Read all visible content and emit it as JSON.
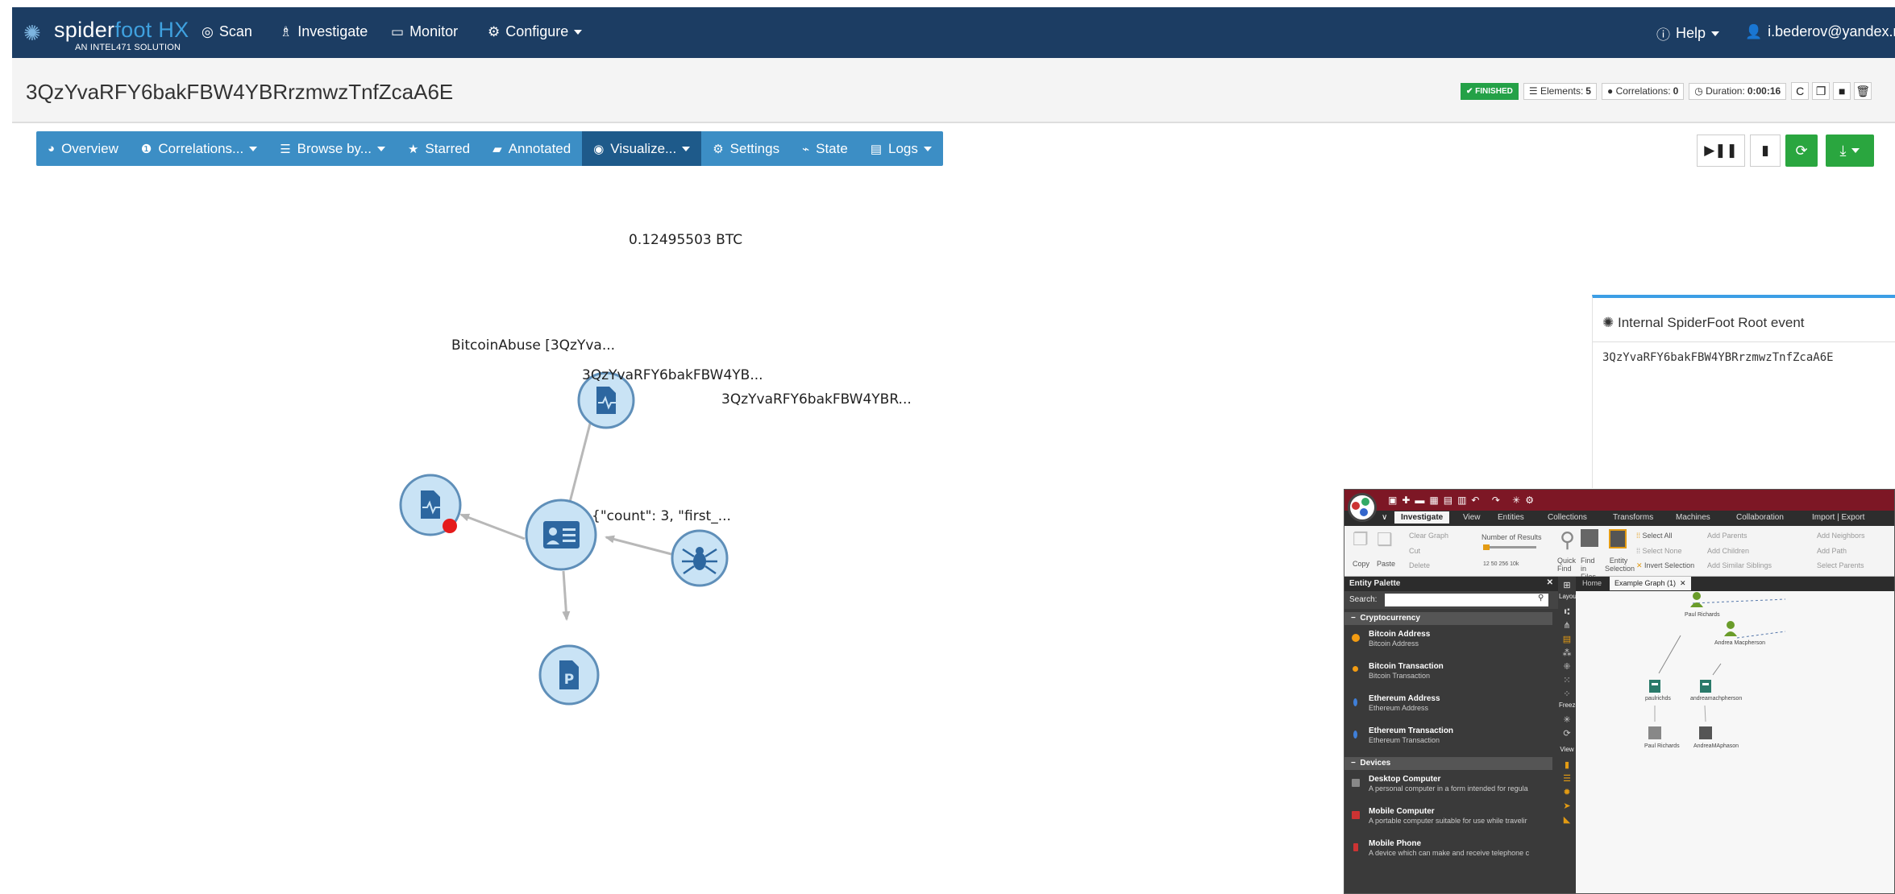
{
  "brand": {
    "name_a": "spider",
    "name_b": "foot HX",
    "tagline": "AN INTEL471 SOLUTION"
  },
  "nav": {
    "items": [
      {
        "label": "Scan",
        "icon": "scan-icon"
      },
      {
        "label": "Investigate",
        "icon": "investigate-icon"
      },
      {
        "label": "Monitor",
        "icon": "monitor-icon"
      },
      {
        "label": "Configure",
        "icon": "cogs-icon"
      }
    ],
    "help": "Help",
    "user": "i.bederov@yandex.ru"
  },
  "scan": {
    "title": "3QzYvaRFY6bakFBW4YBRrzmwzTnfZcaA6E",
    "status": "FINISHED",
    "elements_label": "Elements:",
    "elements": "5",
    "correlations_label": "Correlations:",
    "correlations": "0",
    "duration_label": "Duration:",
    "duration": "0:00:16"
  },
  "tabs": [
    {
      "label": "Overview",
      "icon": "dashboard-icon"
    },
    {
      "label": "Correlations...",
      "icon": "exclamation-icon"
    },
    {
      "label": "Browse by...",
      "icon": "list-icon"
    },
    {
      "label": "Starred",
      "icon": "star-icon"
    },
    {
      "label": "Annotated",
      "icon": "note-icon"
    },
    {
      "label": "Visualize...",
      "icon": "eye-icon",
      "active": true
    },
    {
      "label": "Settings",
      "icon": "gear-icon"
    },
    {
      "label": "State",
      "icon": "pulse-icon"
    },
    {
      "label": "Logs",
      "icon": "log-icon"
    }
  ],
  "graph": {
    "nodes": [
      {
        "label": "0.12495503 BTC",
        "icon": "document-pulse-icon"
      },
      {
        "label": "BitcoinAbuse [3QzYva...",
        "icon": "document-pulse-icon"
      },
      {
        "label": "3QzYvaRFY6bakFBW4YB...",
        "icon": "id-card-icon"
      },
      {
        "label": "3QzYvaRFY6bakFBW4YBR...",
        "icon": "spider-icon"
      },
      {
        "label": "{\"count\": 3, \"first_...",
        "icon": "document-p-icon"
      }
    ]
  },
  "detail_panel": {
    "title": "Internal SpiderFoot Root event",
    "value": "3QzYvaRFY6bakFBW4YBRrzmwzTnfZcaA6E"
  },
  "maltego": {
    "tabs": [
      "Investigate",
      "View",
      "Entities",
      "Collections",
      "Transforms",
      "Machines",
      "Collaboration",
      "Import | Export"
    ],
    "ribbon": {
      "copy": "Copy",
      "paste": "Paste",
      "clear_graph": "Clear Graph",
      "cut": "Cut",
      "delete": "Delete",
      "num_results": "Number of Results",
      "ticks": "12  50  256  10k",
      "quick_find": "Quick Find",
      "find_in_files": "Find in Files",
      "entity_selection": "Entity Selection",
      "select_all": "Select All",
      "select_none": "Select None",
      "invert_selection": "Invert Selection",
      "add_parents": "Add Parents",
      "add_children": "Add Children",
      "add_similar": "Add Similar Siblings",
      "add_neighbors": "Add Neighbors",
      "add_path": "Add Path",
      "select_parents": "Select Parents"
    },
    "palette": {
      "title": "Entity Palette",
      "search_label": "Search:",
      "categories": [
        {
          "name": "Cryptocurrency",
          "items": [
            {
              "title": "Bitcoin Address",
              "desc": "Bitcoin Address"
            },
            {
              "title": "Bitcoin Transaction",
              "desc": "Bitcoin Transaction"
            },
            {
              "title": "Ethereum Address",
              "desc": "Ethereum Address"
            },
            {
              "title": "Ethereum Transaction",
              "desc": "Ethereum Transaction"
            }
          ]
        },
        {
          "name": "Devices",
          "items": [
            {
              "title": "Desktop Computer",
              "desc": "A personal computer in a form intended for regula"
            },
            {
              "title": "Mobile Computer",
              "desc": "A portable computer suitable for use while travelir"
            },
            {
              "title": "Mobile Phone",
              "desc": "A device which can make and receive telephone c"
            }
          ]
        }
      ]
    },
    "side": {
      "layout": "Layout",
      "freeze": "Freeze",
      "view": "View"
    },
    "graph_tabs": {
      "home": "Home",
      "active": "Example Graph (1)"
    },
    "graph_labels": [
      "Paul Richards",
      "Andrea Macpherson",
      "paulrichds",
      "andreamachpherson",
      "Paul Richards",
      "AndreaMAphason"
    ]
  }
}
